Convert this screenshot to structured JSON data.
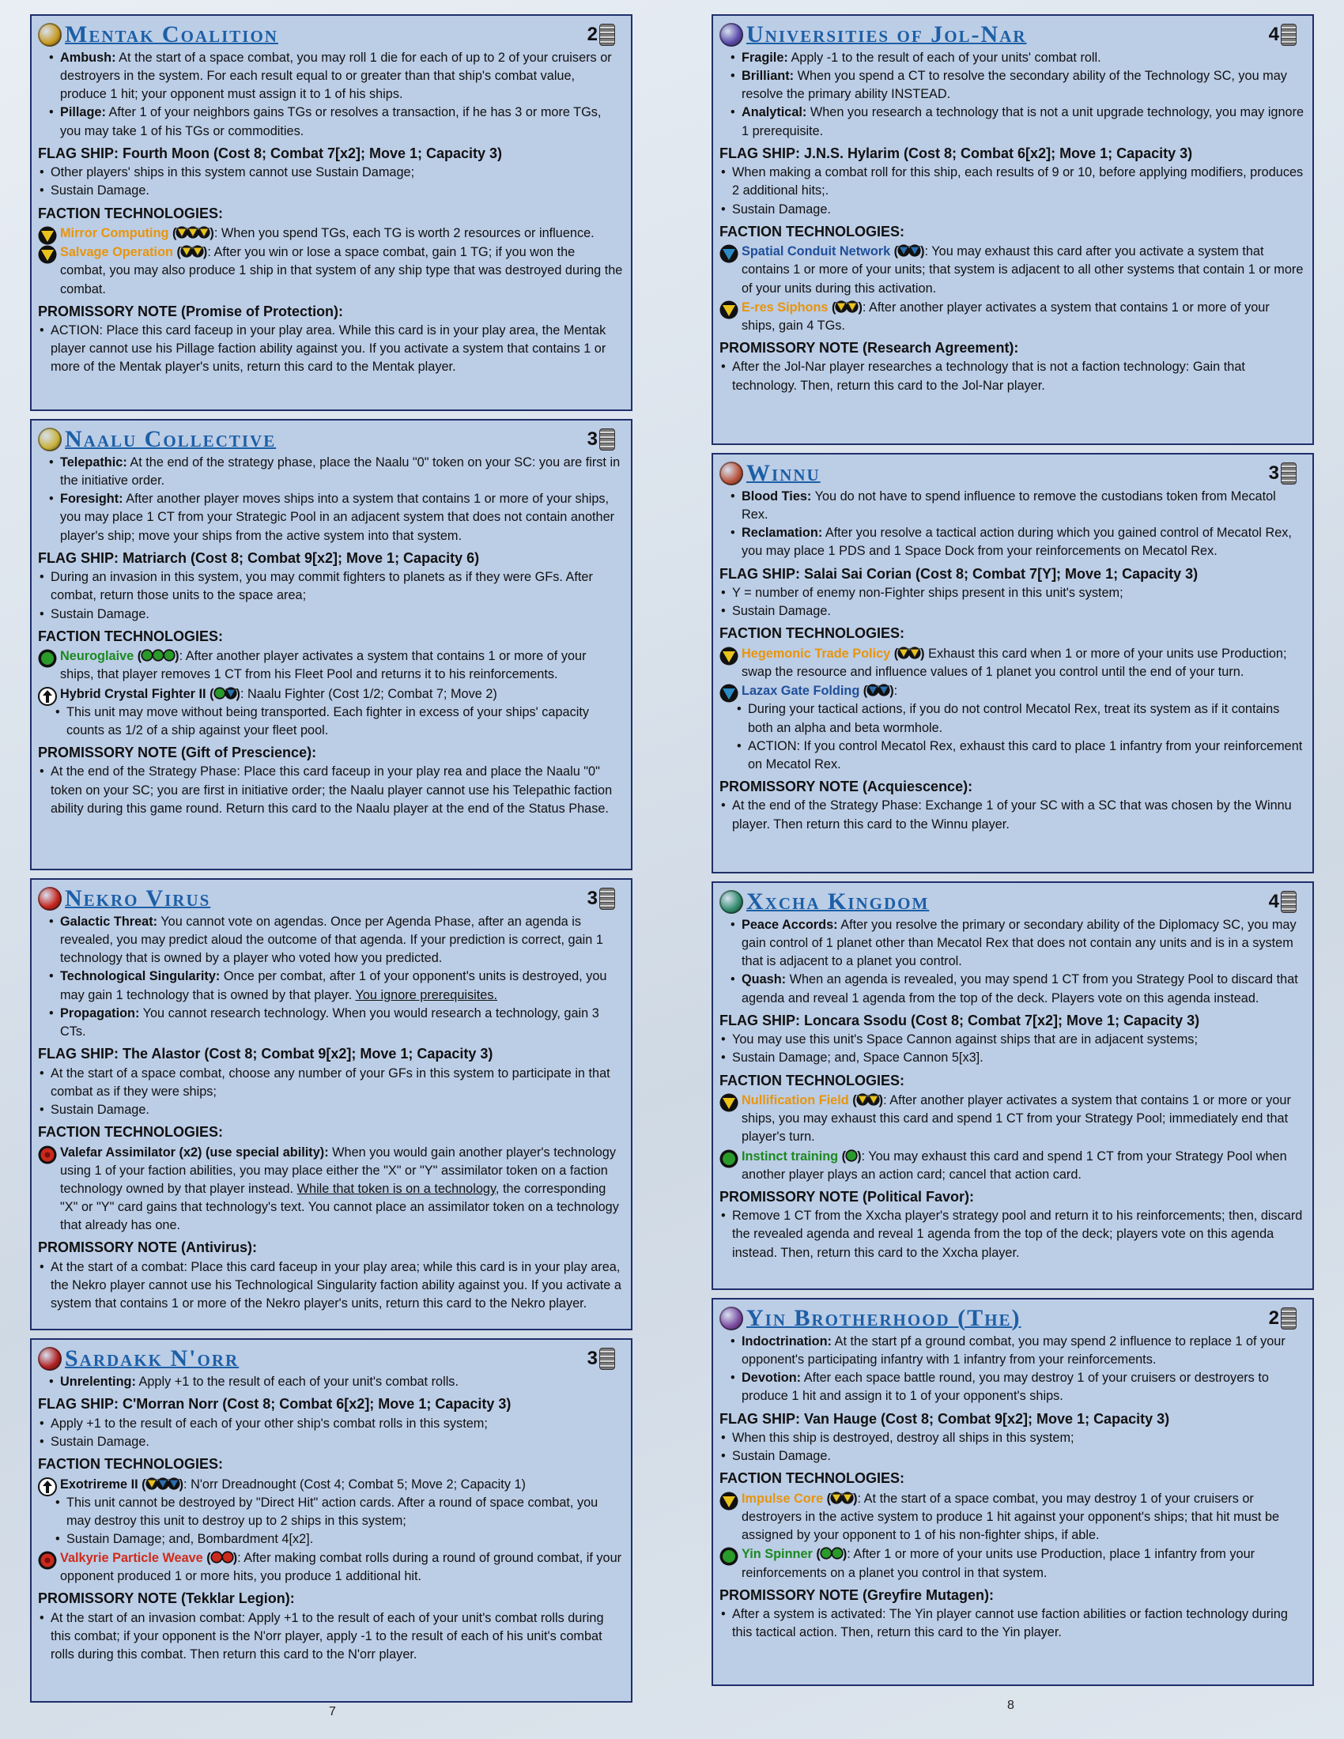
{
  "page_numbers": [
    "7",
    "8"
  ],
  "factions": [
    {
      "name": "Mentak Coalition",
      "emblem_color": "#c79a22",
      "commodities": "2",
      "abilities": [
        {
          "name": "Ambush:",
          "text": "At the start of a space combat, you may roll 1 die for each of up to 2 of your cruisers or destroyers in the system. For each result equal to or greater than that ship's combat value, produce 1 hit; your opponent must assign it to 1 of his ships."
        },
        {
          "name": "Pillage:",
          "text": "After 1 of your neighbors gains TGs or resolves a transaction, if he has 3 or more TGs, you may take 1 of his TGs or commodities."
        }
      ],
      "flagship_title": "FLAG SHIP: Fourth Moon (Cost 8; Combat 7[x2]; Move 1; Capacity 3)",
      "flagship_items": [
        "Other players' ships in this system cannot use Sustain Damage;",
        "Sustain Damage."
      ],
      "tech_title": "FACTION TECHNOLOGIES:",
      "techs": [
        {
          "name": "Mirror Computing",
          "color": "yellow",
          "icon": "yellow-triangle",
          "pips": [
            "yellow",
            "yellow",
            "yellow"
          ],
          "text": ": When you spend TGs, each TG is worth 2 resources or influence."
        },
        {
          "name": "Salvage Operation",
          "color": "yellow",
          "icon": "yellow-triangle",
          "pips": [
            "yellow",
            "yellow"
          ],
          "text": ": After you win or lose a space combat, gain 1 TG; if you won the combat, you may also produce 1 ship in that system of any ship type that was destroyed during the combat."
        }
      ],
      "pn_title": "PROMISSORY NOTE (Promise of Protection):",
      "pn_items": [
        "ACTION: Place this card faceup in your play area. While this card is in your play area, the Mentak player cannot use his Pillage faction ability against you. If you activate a system that contains 1 or more of the Mentak player's units, return this card to the Mentak player."
      ]
    },
    {
      "name": "Naalu Collective",
      "emblem_color": "#c8b13a",
      "commodities": "3",
      "abilities": [
        {
          "name": "Telepathic:",
          "text": "At the end of the strategy phase, place the Naalu \"0\" token on your SC: you are first in the initiative order."
        },
        {
          "name": "Foresight:",
          "text": "After another player moves ships into a system that contains 1 or more of your ships,  you may place 1 CT from your Strategic Pool in an adjacent system that does not contain another player's ship; move your ships from the active system into that system."
        }
      ],
      "flagship_title": "FLAG SHIP: Matriarch (Cost 8; Combat 9[x2]; Move 1; Capacity 6)",
      "flagship_items": [
        "During an invasion in this system, you may commit fighters to planets as if they were GFs. After combat, return those units to the space area;",
        "Sustain Damage."
      ],
      "tech_title": "FACTION TECHNOLOGIES:",
      "techs": [
        {
          "name": "Neuroglaive",
          "color": "green",
          "icon": "green-circle",
          "pips": [
            "green",
            "green",
            "green"
          ],
          "text": ": After another player activates a system that contains 1 or more of your ships, that player removes 1 CT from his Fleet Pool and returns it to his reinforcements."
        },
        {
          "name": "Hybrid Crystal Fighter II",
          "color": "black",
          "icon": "unit-upgrade-arrow",
          "pips": [
            "green",
            "blue"
          ],
          "text": ": Naalu Fighter (Cost 1/2; Combat 7; Move 2)",
          "sub": [
            "This unit may move without being transported. Each fighter in excess of your ships' capacity counts as 1/2 of a ship against your fleet pool."
          ]
        }
      ],
      "pn_title": "PROMISSORY NOTE (Gift of Prescience):",
      "pn_items": [
        "At the end of the Strategy Phase: Place this card faceup in your play rea and place the Naalu \"0\" token on your SC; you are first in initiative order; the Naalu player cannot use his Telepathic faction ability during this game round. Return this card to the Naalu player at the end of the Status Phase."
      ]
    },
    {
      "name": "Nekro Virus",
      "emblem_color": "#c4231a",
      "commodities": "3",
      "abilities": [
        {
          "name": "Galactic Threat:",
          "text": "You cannot vote on agendas. Once per Agenda Phase, after an agenda is revealed, you may predict aloud the outcome of that agenda. If your prediction is correct, gain 1 technology that is owned by a player who voted how you predicted."
        },
        {
          "name": "Technological Singularity:",
          "text": "Once per combat, after 1 of your opponent's units is destroyed, you may gain 1 technology that is owned by that player. ",
          "underline": "You ignore prerequisites."
        },
        {
          "name": "Propagation:",
          "text": "You cannot research technology. When you would research a technology, gain 3 CTs."
        }
      ],
      "flagship_title": "FLAG SHIP: The Alastor (Cost 8; Combat 9[x2]; Move 1; Capacity 3)",
      "flagship_items": [
        "At the start of a space combat, choose any number of your GFs in this system to participate in that combat as if they were ships;",
        "Sustain Damage."
      ],
      "tech_title": "FACTION TECHNOLOGIES:",
      "techs": [
        {
          "name": "Valefar Assimilator (x2) (use special ability):",
          "color": "black",
          "icon": "red-emblem",
          "pips": [],
          "text": " When you would gain another player's technology using 1 of your faction abilities, you may place either the \"X\" or \"Y\" assimilator token on a faction technology owned by that player instead. ",
          "underline": "While that token is on a technology",
          "text2": ", the corresponding \"X\" or \"Y\" card gains that technology's text. You cannot place an assimilator token on a technology that already has one."
        }
      ],
      "pn_title": "PROMISSORY NOTE (Antivirus):",
      "pn_items": [
        "At the start of a combat: Place this card faceup in your play area; while this card is in your play area, the Nekro player cannot use his Technological Singularity faction ability against you. If you activate a system that contains 1 or more of the Nekro player's units, return this card to the Nekro player."
      ]
    },
    {
      "name": "Sardakk N'orr",
      "emblem_color": "#b01e1e",
      "commodities": "3",
      "abilities": [
        {
          "name": "Unrelenting:",
          "text": "Apply +1 to the result of each of your unit's combat rolls."
        }
      ],
      "flagship_title": "FLAG SHIP: C'Morran Norr (Cost 8; Combat 6[x2]; Move 1; Capacity 3)",
      "flagship_items": [
        "Apply +1 to the result of each of your other ship's combat rolls in this system;",
        "Sustain Damage."
      ],
      "tech_title": "FACTION  TECHNOLOGIES:",
      "techs": [
        {
          "name": "Exotrireme II",
          "color": "black",
          "icon": "unit-upgrade-arrow",
          "pips": [
            "yellow",
            "blue",
            "blue"
          ],
          "text": ": N'orr Dreadnought (Cost 4; Combat 5; Move 2; Capacity 1)",
          "sub": [
            "This unit cannot be destroyed by \"Direct Hit\" action cards. After a round of space combat, you may destroy this unit to destroy up to 2 ships in this system;",
            "Sustain Damage; and, Bombardment 4[x2]."
          ]
        },
        {
          "name": "Valkyrie Particle Weave",
          "color": "red",
          "icon": "red-circle",
          "pips": [
            "red",
            "red"
          ],
          "text": ": After making combat rolls during a round of ground combat, if your opponent produced 1 or more hits, you produce 1 additional hit."
        }
      ],
      "pn_title": "PROMISSORY NOTE (Tekklar Legion):",
      "pn_items": [
        "At the start of an invasion combat: Apply +1 to the result of each of your unit's combat rolls during this combat; if your opponent is the N'orr player, apply -1 to the result of each of his unit's combat rolls during this combat. Then return this card to the N'orr player."
      ]
    },
    {
      "name": "Universities of Jol-Nar",
      "emblem_color": "#5a49a8",
      "commodities": "4",
      "abilities": [
        {
          "name": "Fragile:",
          "text": "Apply -1 to the result of each of your units' combat roll."
        },
        {
          "name": "Brilliant:",
          "text": "When you spend a CT to resolve the secondary ability of the Technology SC, you may resolve the primary ability INSTEAD."
        },
        {
          "name": "Analytical:",
          "text": "When you research a technology that is not a unit upgrade technology, you may ignore 1 prerequisite."
        }
      ],
      "flagship_title": "FLAG SHIP: J.N.S. Hylarim (Cost 8; Combat 6[x2]; Move 1; Capacity 3)",
      "flagship_items": [
        "When making a combat roll for this ship, each results of 9 or 10, before applying modifiers, produces 2 additional hits;.",
        "Sustain Damage."
      ],
      "tech_title": "FACTION TECHNOLOGIES:",
      "techs": [
        {
          "name": "Spatial Conduit Network",
          "color": "blue",
          "icon": "blue-triangle",
          "pips": [
            "blue",
            "blue"
          ],
          "text": ": You may exhaust this card after you activate a system that contains 1 or more of your units; that system is adjacent to all other systems that contain 1 or more of your units during this activation."
        },
        {
          "name": "E-res Siphons",
          "color": "yellow",
          "icon": "yellow-triangle",
          "pips": [
            "yellow",
            "yellow"
          ],
          "text": ": After another player activates a system that contains 1 or more of your ships, gain 4 TGs."
        }
      ],
      "pn_title": "PROMISSORY NOTE (Research Agreement):",
      "pn_items": [
        "After the Jol-Nar player researches a technology that is not a faction technology: Gain that technology. Then, return this card to the Jol-Nar player."
      ]
    },
    {
      "name": "Winnu",
      "emblem_color": "#b8543a",
      "commodities": "3",
      "abilities": [
        {
          "name": "Blood Ties:",
          "text": "You do not have to spend influence to remove the custodians token from Mecatol Rex."
        },
        {
          "name": "Reclamation:",
          "text": "After you resolve a tactical action during which you gained control of Mecatol Rex, you may place 1 PDS and 1 Space Dock from your reinforcements on Mecatol Rex."
        }
      ],
      "flagship_title": "FLAG SHIP: Salai Sai Corian (Cost  8; Combat 7[Y]; Move 1; Capacity 3)",
      "flagship_items": [
        "Y = number of enemy non-Fighter ships present in this unit's system;",
        "Sustain Damage."
      ],
      "tech_title": "FACTION TECHNOLOGIES:",
      "techs": [
        {
          "name": "Hegemonic Trade Policy",
          "color": "yellow",
          "icon": "yellow-triangle",
          "pips": [
            "yellow",
            "yellow"
          ],
          "text": " Exhaust this card when 1 or more of your units use Production; swap the resource and influence values of 1 planet you control until the end of your turn."
        },
        {
          "name": "Lazax Gate Folding",
          "color": "blue",
          "icon": "blue-triangle",
          "pips": [
            "blue",
            "blue"
          ],
          "text": ":",
          "sub": [
            "During your tactical actions, if you do not control Mecatol Rex, treat its system as if it contains both an alpha and beta wormhole.",
            "ACTION: If you control Mecatol Rex, exhaust this card to place 1 infantry from your reinforcement on Mecatol Rex."
          ]
        }
      ],
      "pn_title": "PROMISSORY NOTE (Acquiescence):",
      "pn_items": [
        "At the end of the Strategy Phase: Exchange 1 of your SC with a SC that was chosen by the Winnu player. Then return this card to the Winnu player."
      ]
    },
    {
      "name": "Xxcha Kingdom",
      "emblem_color": "#2f8a6a",
      "commodities": "4",
      "abilities": [
        {
          "name": "Peace Accords:",
          "text": "After you resolve the primary or secondary ability of the Diplomacy SC, you may gain control of 1 planet other than Mecatol Rex that does not contain any units and is in a system that is adjacent to a planet you control."
        },
        {
          "name": "Quash:",
          "text": "When an agenda is revealed, you may spend 1 CT from you Strategy Pool to discard that agenda and reveal 1 agenda from the top of the deck. Players vote on this agenda instead."
        }
      ],
      "flagship_title": "FLAG SHIP: Loncara Ssodu (Cost 8; Combat 7[x2]; Move 1; Capacity 3)",
      "flagship_items": [
        "You may use this unit's Space Cannon against ships that are in adjacent systems;",
        "Sustain Damage; and, Space Cannon 5[x3]."
      ],
      "tech_title": "FACTION TECHNOLOGIES:",
      "techs": [
        {
          "name": "Nullification Field",
          "color": "yellow",
          "icon": "yellow-triangle",
          "pips": [
            "yellow",
            "yellow"
          ],
          "text": ":  After another player activates a system that contains 1 or more or your ships, you may exhaust this card and spend 1 CT from your Strategy Pool; immediately end that player's turn."
        },
        {
          "name": "Instinct training",
          "color": "green",
          "icon": "green-circle",
          "pips": [
            "green"
          ],
          "text": ": You may exhaust this card and spend 1 CT from your Strategy Pool when another player plays an action card; cancel that action card."
        }
      ],
      "pn_title": "PROMISSORY NOTE (Political Favor):",
      "pn_items": [
        "Remove 1 CT from the Xxcha player's strategy pool and return it to his reinforcements; then, discard the revealed agenda and reveal 1 agenda from the top of the deck; players vote on this agenda instead. Then, return this card to the Xxcha player."
      ]
    },
    {
      "name": "Yin Brotherhood (The)",
      "emblem_color": "#7a4aa0",
      "commodities": "2",
      "abilities": [
        {
          "name": "Indoctrination:",
          "text": "At the start pf a ground combat, you may spend 2 influence to replace 1 of your opponent's participating infantry with 1 infantry from your reinforcements."
        },
        {
          "name": "Devotion:",
          "text": "After each space battle round, you may destroy 1 of your cruisers or destroyers to produce 1 hit and assign it to 1 of your opponent's ships."
        }
      ],
      "flagship_title": "FLAG SHIP: Van Hauge (Cost 8; Combat 9[x2]; Move 1; Capacity 3)",
      "flagship_items": [
        "When this ship is destroyed, destroy all ships in this system;",
        "Sustain Damage."
      ],
      "tech_title": "FACTION TECHNOLOGIES:",
      "techs": [
        {
          "name": "Impulse Core",
          "color": "yellow",
          "icon": "yellow-triangle",
          "pips": [
            "yellow",
            "yellow"
          ],
          "text": ": At the start of a space combat, you may destroy 1 of your cruisers or destroyers in the active system to produce 1 hit against your opponent's ships; that hit must be assigned by your opponent to 1 of his non-fighter ships, if able."
        },
        {
          "name": "Yin Spinner",
          "color": "green",
          "icon": "green-circle",
          "pips": [
            "green",
            "green"
          ],
          "text": ": After 1 or more of your units use Production, place 1 infantry from your reinforcements on a planet you control in that system."
        }
      ],
      "pn_title": "PROMISSORY NOTE (Greyfire Mutagen):",
      "pn_items": [
        "After a system is activated: The Yin player cannot use faction abilities or faction technology during this tactical action. Then, return this card to the Yin player."
      ]
    }
  ]
}
